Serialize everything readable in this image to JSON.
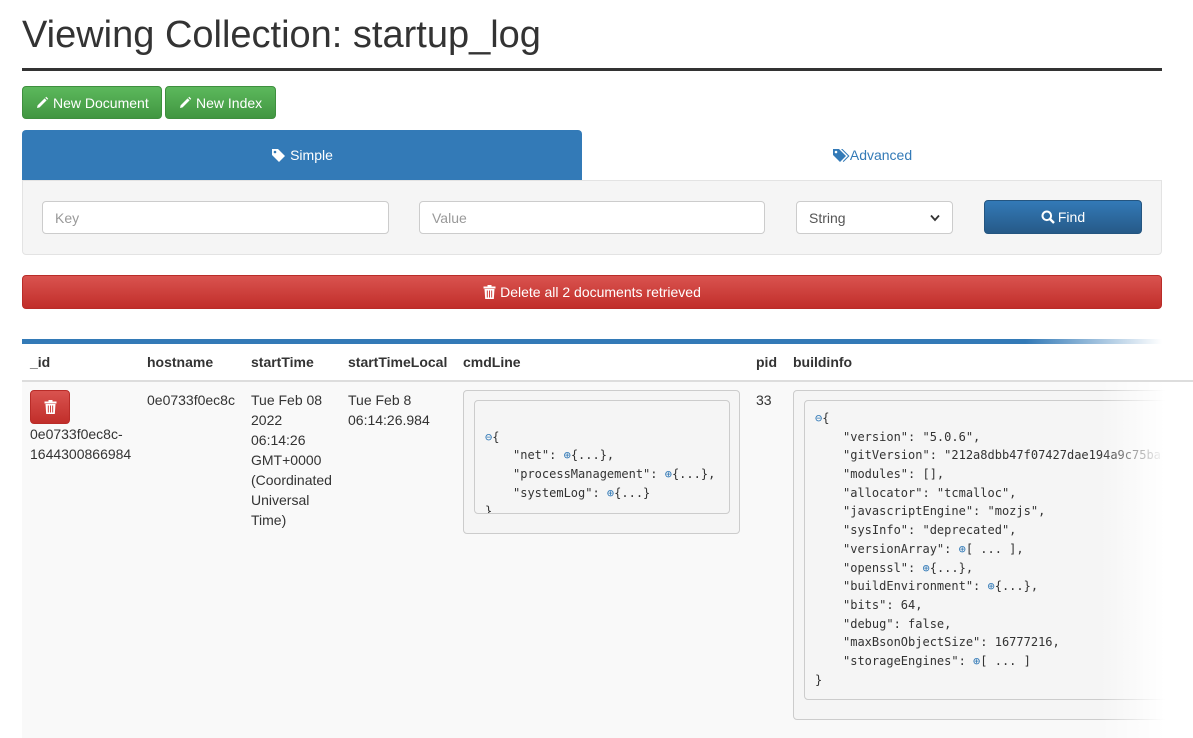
{
  "page": {
    "title": "Viewing Collection: startup_log"
  },
  "toolbar": {
    "new_document_label": "New Document",
    "new_index_label": "New Index"
  },
  "tabs": {
    "simple_label": "Simple",
    "advanced_label": "Advanced"
  },
  "search": {
    "key_placeholder": "Key",
    "value_placeholder": "Value",
    "type_selected": "String",
    "find_label": "Find"
  },
  "delete_all_label": "Delete all 2 documents retrieved",
  "colors": {
    "primary": "#337ab7",
    "success": "#5cb85c",
    "danger": "#d9534f"
  },
  "table": {
    "headers": [
      "_id",
      "hostname",
      "startTime",
      "startTimeLocal",
      "cmdLine",
      "pid",
      "buildinfo"
    ],
    "row": {
      "id_lines": [
        "0e0733f0ec8c-",
        "1644300866984"
      ],
      "hostname": "0e0733f0ec8c",
      "start_time_lines": [
        "Tue Feb 08",
        "2022",
        "06:14:26",
        "GMT+0000",
        "(Coordinated",
        "Universal",
        "Time)"
      ],
      "start_time_local_lines": [
        "Tue Feb 8",
        "06:14:26.984"
      ],
      "pid": "33",
      "cmdline_lines": [
        {
          "key": "\"net\": ",
          "toggle": "⊕",
          "value": "{...},"
        },
        {
          "key": "\"processManagement\": ",
          "toggle": "⊕",
          "value": "{...},"
        },
        {
          "key": "\"systemLog\": ",
          "toggle": "⊕",
          "value": "{...}"
        }
      ],
      "buildinfo_lines": [
        {
          "key": "\"version\": ",
          "toggle": "",
          "value": "\"5.0.6\","
        },
        {
          "key": "\"gitVersion\": ",
          "toggle": "",
          "value": "\"212a8dbb47f07427dae194a9c75ba"
        },
        {
          "key": "\"modules\": ",
          "toggle": "",
          "value": "[],"
        },
        {
          "key": "\"allocator\": ",
          "toggle": "",
          "value": "\"tcmalloc\","
        },
        {
          "key": "\"javascriptEngine\": ",
          "toggle": "",
          "value": "\"mozjs\","
        },
        {
          "key": "\"sysInfo\": ",
          "toggle": "",
          "value": "\"deprecated\","
        },
        {
          "key": "\"versionArray\": ",
          "toggle": "⊕",
          "value": "[ ... ],"
        },
        {
          "key": "\"openssl\": ",
          "toggle": "⊕",
          "value": "{...},"
        },
        {
          "key": "\"buildEnvironment\": ",
          "toggle": "⊕",
          "value": "{...},"
        },
        {
          "key": "\"bits\": ",
          "toggle": "",
          "value": "64,"
        },
        {
          "key": "\"debug\": ",
          "toggle": "",
          "value": "false,"
        },
        {
          "key": "\"maxBsonObjectSize\": ",
          "toggle": "",
          "value": "16777216,"
        },
        {
          "key": "\"storageEngines\": ",
          "toggle": "⊕",
          "value": "[ ... ]"
        }
      ],
      "json_open": "{",
      "json_close": "}",
      "collapse_toggle": "⊖"
    }
  }
}
